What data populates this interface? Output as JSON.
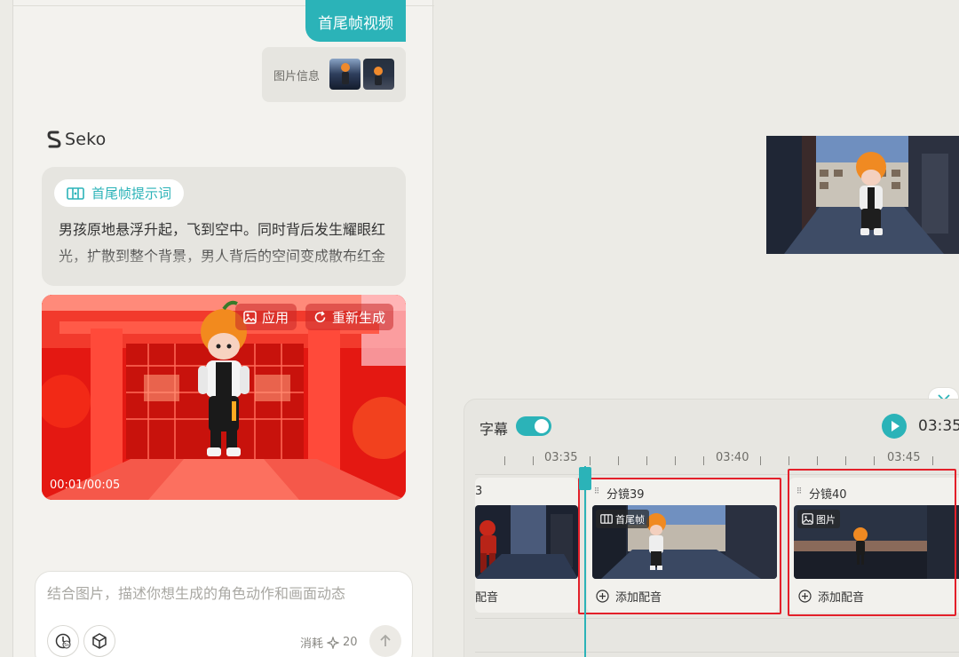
{
  "chat": {
    "user_message": "首尾帧视频",
    "image_info_label": "图片信息",
    "brand": "Seko",
    "prompt_tag": "首尾帧提示词",
    "prompt_text": "男孩原地悬浮升起，飞到空中。同时背后发生耀眼红光，扩散到整个背景，男人背后的空间变成散布红金",
    "video": {
      "apply_label": "应用",
      "regenerate_label": "重新生成",
      "time": "00:01/00:05"
    },
    "input": {
      "placeholder": "结合图片，描述你想生成的角色动作和画面动态",
      "cost_label": "消耗",
      "cost_value": "20"
    }
  },
  "timeline": {
    "subtitle_label": "字幕",
    "subtitle_enabled": true,
    "current_time": "03:35",
    "ruler_labels": [
      "03:35",
      "03:40",
      "03:45"
    ],
    "clips": [
      {
        "title": "3",
        "add_label": "配音"
      },
      {
        "title": "分镜39",
        "badge": "首尾帧",
        "add_label": "添加配音"
      },
      {
        "title": "分镜40",
        "badge": "图片",
        "add_label": "添加配音"
      }
    ]
  },
  "colors": {
    "accent": "#2bb3b8",
    "highlight": "#e3202a"
  }
}
